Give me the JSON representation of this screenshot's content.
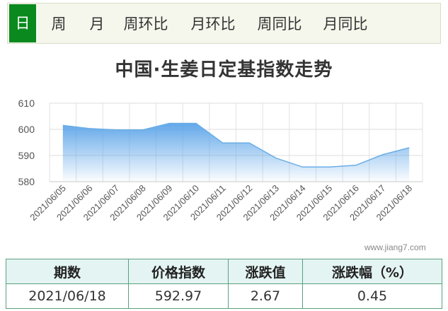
{
  "tabs": [
    {
      "label": "日",
      "active": true
    },
    {
      "label": "周",
      "active": false
    },
    {
      "label": "月",
      "active": false
    },
    {
      "label": "周环比",
      "active": false
    },
    {
      "label": "月环比",
      "active": false
    },
    {
      "label": "周同比",
      "active": false
    },
    {
      "label": "月同比",
      "active": false
    }
  ],
  "chart_title": "中国·生姜日定基指数走势",
  "watermark": "www.jiang7.com",
  "colors": {
    "accent": "#0a8a1e",
    "line": "#6aaee6",
    "fill_top": "#6aaee6",
    "table_border": "#5aa07e",
    "table_header_bg": "#e4f4f2"
  },
  "chart_data": {
    "type": "area",
    "title": "中国·生姜日定基指数走势",
    "x": [
      "2021/06/05",
      "2021/06/06",
      "2021/06/07",
      "2021/06/08",
      "2021/06/09",
      "2021/06/10",
      "2021/06/11",
      "2021/06/12",
      "2021/06/13",
      "2021/06/14",
      "2021/06/15",
      "2021/06/16",
      "2021/06/17",
      "2021/06/18"
    ],
    "values": [
      601.5,
      600.3,
      599.8,
      599.8,
      602.3,
      602.3,
      594.8,
      594.8,
      589.0,
      585.6,
      585.6,
      586.3,
      590.3,
      592.97
    ],
    "ylim": [
      580,
      610
    ],
    "yticks": [
      580,
      590,
      600,
      610
    ],
    "grid": true,
    "xlabel": "",
    "ylabel": ""
  },
  "table": {
    "headers": [
      "期数",
      "价格指数",
      "涨跌值",
      "涨跌幅（%）"
    ],
    "row": [
      "2021/06/18",
      "592.97",
      "2.67",
      "0.45"
    ]
  }
}
